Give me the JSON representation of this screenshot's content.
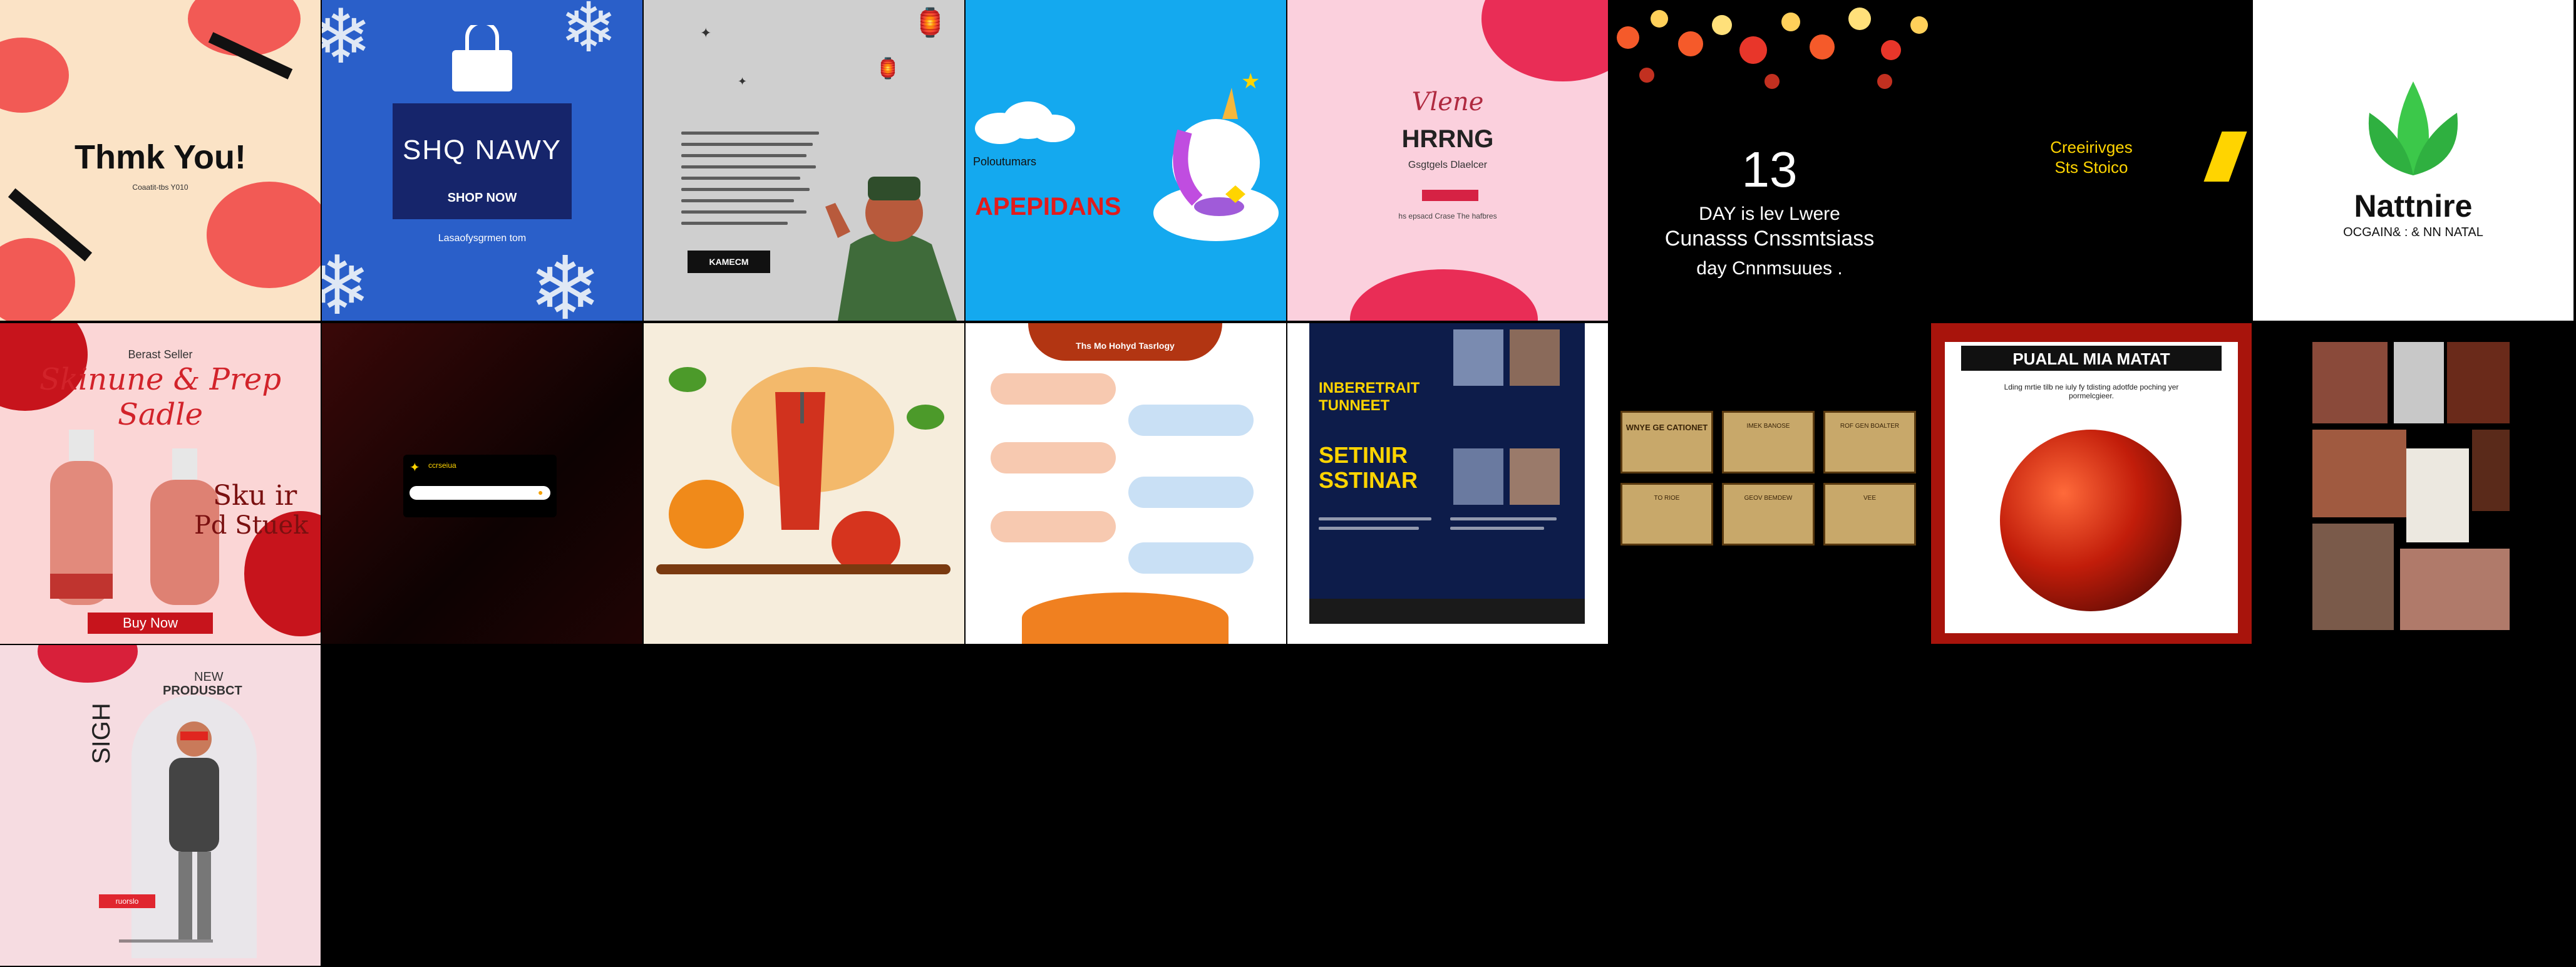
{
  "tiles": {
    "t1": {
      "title": "Thmk You!",
      "sub": "Coaatit-tbs Y010"
    },
    "t2": {
      "title": "SHQ NAWY",
      "cta": "SHOP NOW",
      "footer": "Lasaofysgrmen tom"
    },
    "t3": {
      "button": "KAMECM"
    },
    "t4": {
      "small": "Poloutumars",
      "title": "APEPIDANS"
    },
    "t5": {
      "script": "Vlene",
      "title": "HRRNG",
      "sub": "Gsgtgels Dlaelcer",
      "foot": "hs epsacd Crase The hafbres"
    },
    "t6": {
      "number": "13",
      "line1": "DAY is lev Lwere",
      "line2": "Cunasss Cnssmtsiass",
      "line3": "day Cnnmsuues ."
    },
    "t7": {
      "line1": "Creeirivges",
      "line2": "Sts Stoico"
    },
    "t8": {
      "title": "Nattnire",
      "sub": "OCGAIN& : & NN NATAL"
    },
    "t9": {
      "small": "Berast Seller",
      "title": "Skinune & Prep Sadle",
      "big": "Sku ir",
      "big2": "Pd Stuek",
      "cta": "Buy Now"
    },
    "t10": {
      "small": "ccrseiua"
    },
    "t12": {
      "title": "Ths Mo Hohyd Tasrlogy"
    },
    "t13": {
      "title1": "INBERETRAIT",
      "title2": "TUNNEET",
      "title3": "SETINIR",
      "title4": "SSTINAR"
    },
    "t14": {
      "cards": [
        "WNYE GE CATIONET",
        "IMEK BANOSE",
        "ROF GEN BOALTER",
        "TO RIOE",
        "GEOV BEMDEW",
        "VEE"
      ]
    },
    "t15": {
      "title": "PUALAL MIA MATAT",
      "sub": "Lding mrtie tilb ne iuly fy tdisting adotfde poching yer pormelcgieer."
    },
    "t17": {
      "badge": "NEW",
      "title": "PRODUSBCT",
      "side": "SIGH",
      "cta": "ruorslo"
    }
  }
}
